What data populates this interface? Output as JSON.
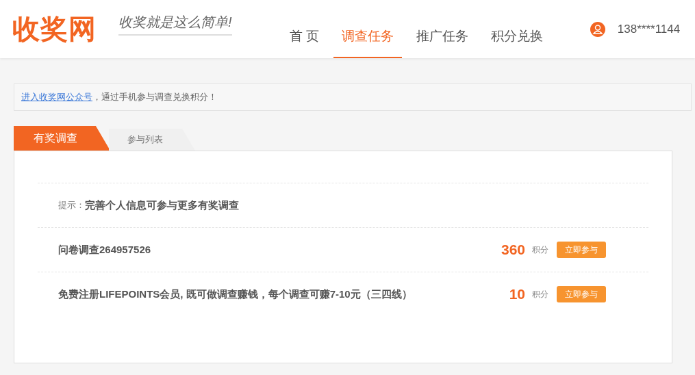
{
  "header": {
    "logo": "收奖网",
    "slogan": "收奖就是这么简单!",
    "nav": [
      {
        "label": "首 页",
        "selected": false
      },
      {
        "label": "调查任务",
        "selected": true
      },
      {
        "label": "推广任务",
        "selected": false
      },
      {
        "label": "积分兑换",
        "selected": false
      }
    ],
    "user": "138****1144"
  },
  "notice": {
    "link": "进入收奖网公众号",
    "text": "，通过手机参与调查兑换积分！"
  },
  "tabs": [
    {
      "label": "有奖调查",
      "selected": true
    },
    {
      "label": "参与列表",
      "selected": false
    }
  ],
  "tip": {
    "label": "提示：",
    "text": "完善个人信息可参与更多有奖调查"
  },
  "surveys": [
    {
      "title": "问卷调查264957526",
      "points": "360",
      "unit": "积分",
      "button": "立即参与"
    },
    {
      "title": "免费注册LIFEPOINTS会员, 既可做调查赚钱，每个调查可赚7-10元（三四线）",
      "points": "10",
      "unit": "积分",
      "button": "立即参与"
    }
  ]
}
